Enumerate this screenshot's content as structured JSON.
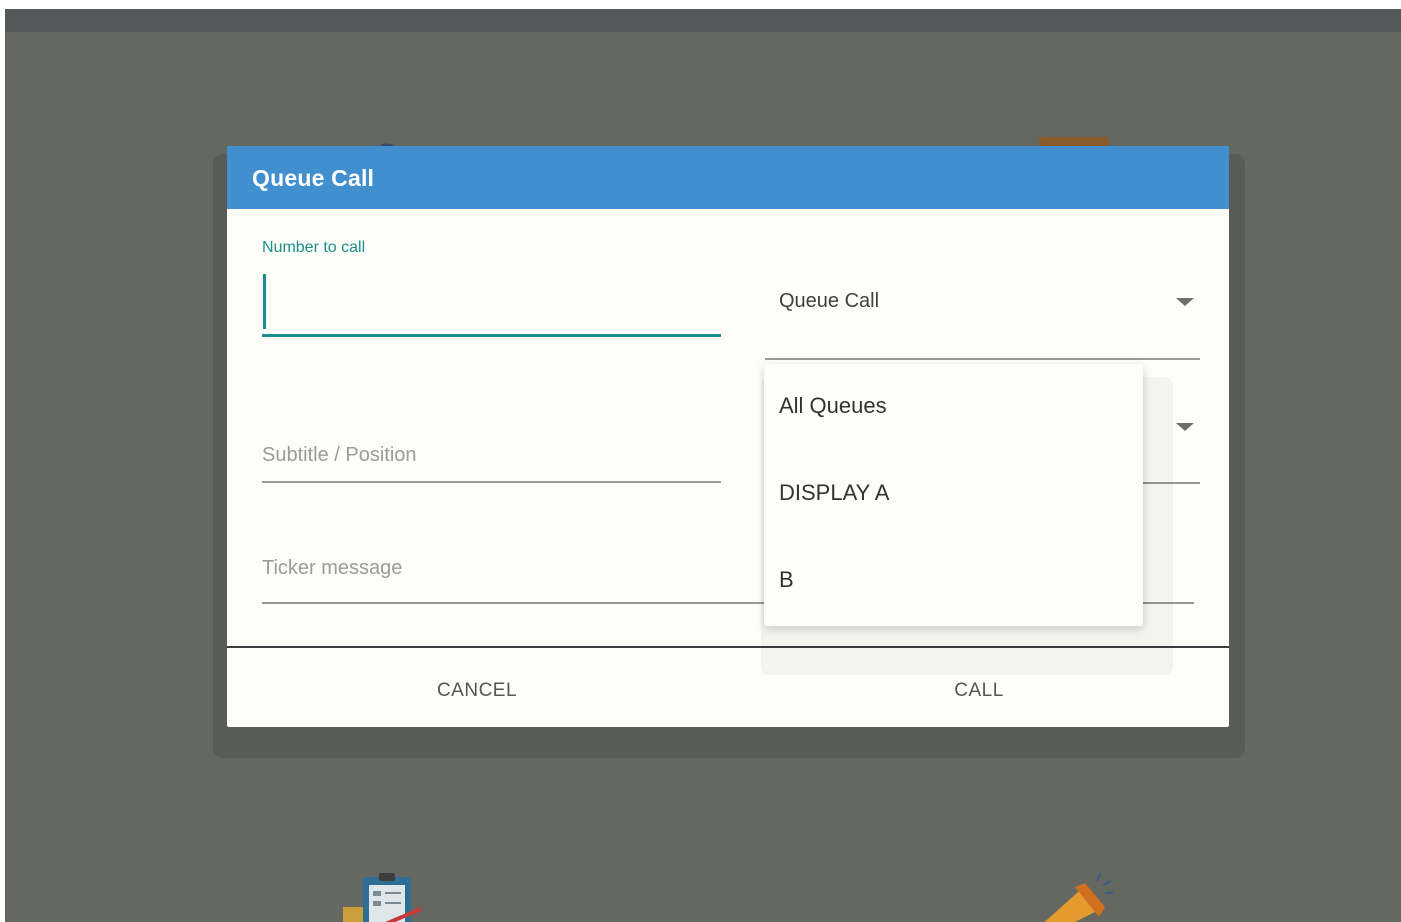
{
  "dialog": {
    "title": "Queue Call",
    "number_label": "Number to call",
    "number_value": "",
    "subtitle_placeholder": "Subtitle / Position",
    "ticker_placeholder": "Ticker message",
    "queue_select": {
      "selected": "Queue Call",
      "options": [
        "All Queues",
        "DISPLAY A",
        "B"
      ]
    },
    "buttons": {
      "cancel": "CANCEL",
      "call": "CALL"
    }
  },
  "colors": {
    "header": "#418fce",
    "accent": "#1a8f8d",
    "overlay": "#646860",
    "dialog_bg": "#fefef9"
  }
}
